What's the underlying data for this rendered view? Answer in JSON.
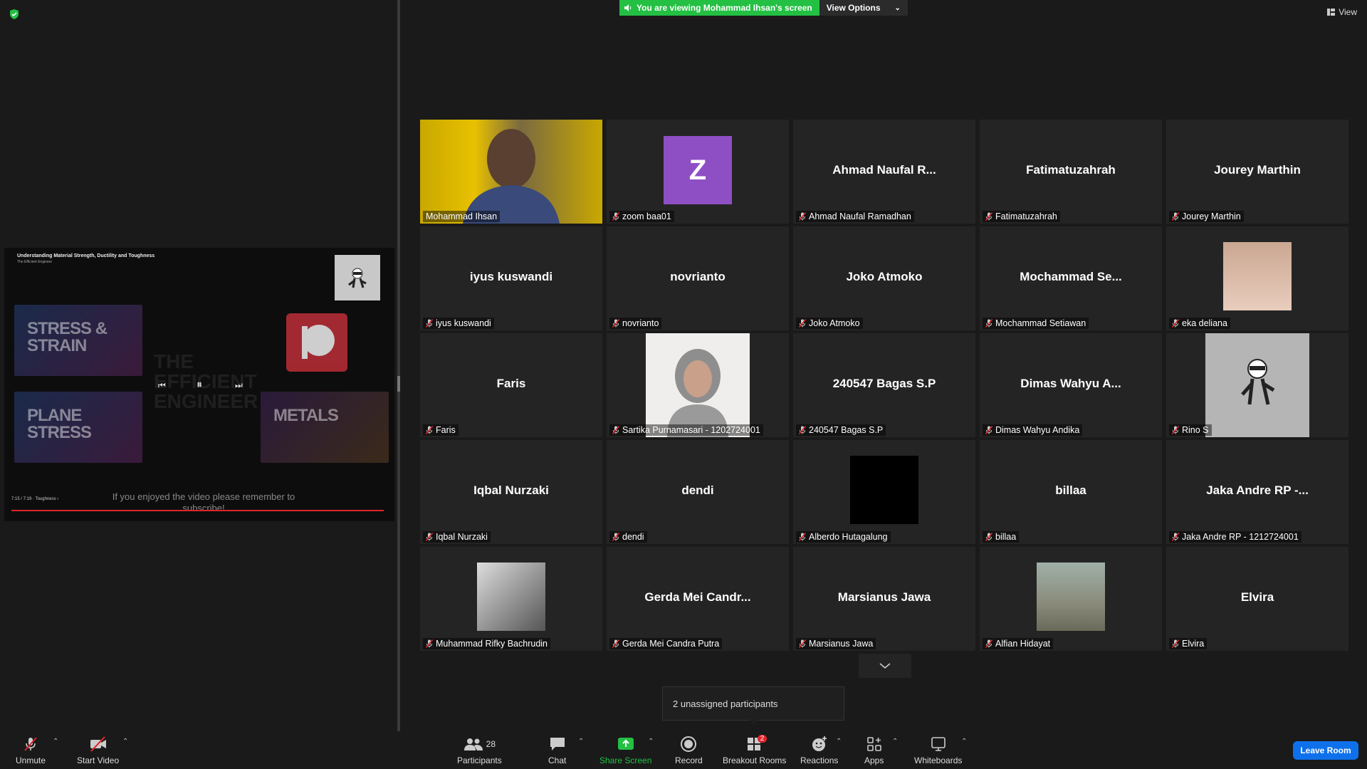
{
  "banner": {
    "viewing_text": "You are viewing Mohammad Ihsan's screen",
    "view_options": "View Options",
    "view": "View"
  },
  "shared_video": {
    "title": "Understanding Material Strength, Ductility and Toughness",
    "channel": "The Efficient Engineer",
    "tile1": "STRESS & STRAIN",
    "tile2": "PLANE STRESS",
    "tile3": "METALS",
    "center_text": "THE EFFICIENT ENGINEER",
    "subtitle": "If you enjoyed the video please remember to subscribe!",
    "time": "7:15 / 7:19 · Toughness ›",
    "progress": 0.99
  },
  "participants": [
    {
      "display": "",
      "label": "Mohammad Ihsan",
      "muted": false,
      "kind": "video"
    },
    {
      "display": "Z",
      "label": "zoom baa01",
      "muted": true,
      "kind": "avatar"
    },
    {
      "display": "Ahmad  Naufal  R...",
      "label": "Ahmad Naufal Ramadhan",
      "muted": true,
      "kind": "name"
    },
    {
      "display": "Fatimatuzahrah",
      "label": "Fatimatuzahrah",
      "muted": true,
      "kind": "name"
    },
    {
      "display": "Jourey Marthin",
      "label": "Jourey Marthin",
      "muted": true,
      "kind": "name"
    },
    {
      "display": "iyus kuswandi",
      "label": "iyus kuswandi",
      "muted": true,
      "kind": "name"
    },
    {
      "display": "novrianto",
      "label": "novrianto",
      "muted": true,
      "kind": "name"
    },
    {
      "display": "Joko Atmoko",
      "label": "Joko Atmoko",
      "muted": true,
      "kind": "name"
    },
    {
      "display": "Mochammad  Se...",
      "label": "Mochammad Setiawan",
      "muted": true,
      "kind": "name"
    },
    {
      "display": "",
      "label": "eka deliana",
      "muted": true,
      "kind": "photo"
    },
    {
      "display": "Faris",
      "label": "Faris",
      "muted": true,
      "kind": "name"
    },
    {
      "display": "",
      "label": "Sartika Purnamasari - 1202724001",
      "muted": true,
      "kind": "photo"
    },
    {
      "display": "240547 Bagas S.P",
      "label": "240547 Bagas S.P",
      "muted": true,
      "kind": "name"
    },
    {
      "display": "Dimas  Wahyu  A...",
      "label": "Dimas Wahyu Andika",
      "muted": true,
      "kind": "name"
    },
    {
      "display": "",
      "label": "Rino S",
      "muted": true,
      "kind": "photo"
    },
    {
      "display": "Iqbal Nurzaki",
      "label": "Iqbal Nurzaki",
      "muted": true,
      "kind": "name"
    },
    {
      "display": "dendi",
      "label": "dendi",
      "muted": true,
      "kind": "name"
    },
    {
      "display": "",
      "label": "Alberdo Hutagalung",
      "muted": true,
      "kind": "photo"
    },
    {
      "display": "billaa",
      "label": "billaa",
      "muted": true,
      "kind": "name"
    },
    {
      "display": "Jaka Andre RP -...",
      "label": "Jaka Andre RP - 1212724001",
      "muted": true,
      "kind": "name"
    },
    {
      "display": "",
      "label": "Muhammad Rifky Bachrudin",
      "muted": true,
      "kind": "photo"
    },
    {
      "display": "Gerda Mei Candr...",
      "label": "Gerda Mei Candra Putra",
      "muted": true,
      "kind": "name"
    },
    {
      "display": "Marsianus Jawa",
      "label": "Marsianus Jawa",
      "muted": true,
      "kind": "name"
    },
    {
      "display": "",
      "label": "Alfian Hidayat",
      "muted": true,
      "kind": "photo"
    },
    {
      "display": "Elvira",
      "label": "Elvira",
      "muted": true,
      "kind": "name"
    }
  ],
  "popup": {
    "unassigned": "2 unassigned participants"
  },
  "toolbar": {
    "unmute": "Unmute",
    "start_video": "Start Video",
    "participants": "Participants",
    "participants_count": "28",
    "chat": "Chat",
    "share_screen": "Share Screen",
    "record": "Record",
    "breakout_rooms": "Breakout Rooms",
    "breakout_badge": "2",
    "reactions": "Reactions",
    "apps": "Apps",
    "whiteboards": "Whiteboards",
    "leave_room": "Leave Room"
  },
  "colors": {
    "accent": "#23c043",
    "active_border": "#f1e779",
    "leave": "#0e71eb",
    "muted_mic": "#e0242c",
    "avatar": "#8e4fc4"
  }
}
